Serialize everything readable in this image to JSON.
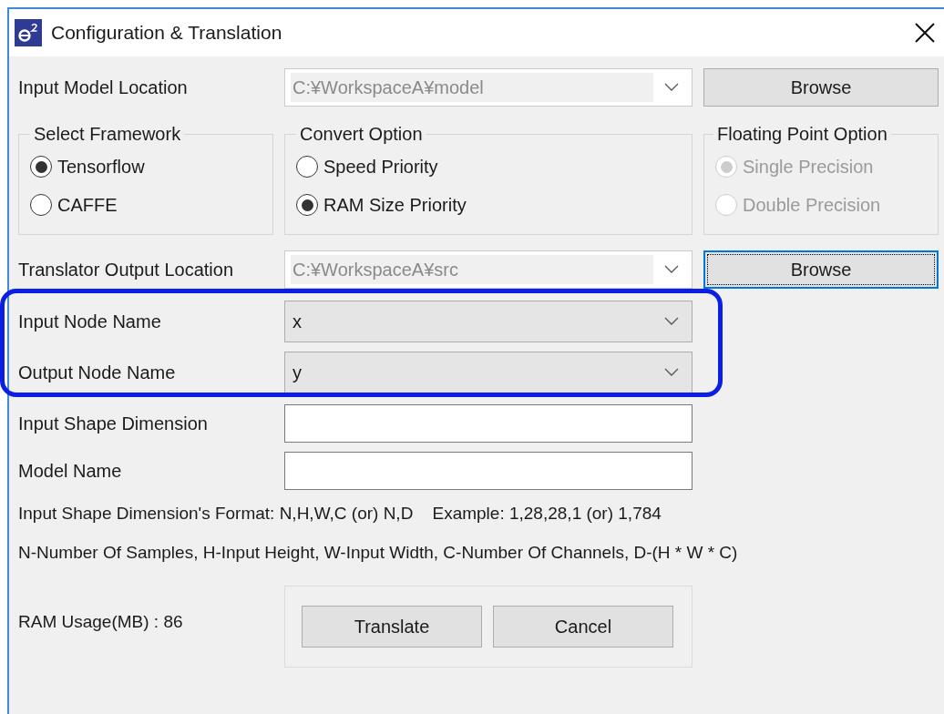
{
  "window": {
    "title": "Configuration & Translation"
  },
  "input_model_location": {
    "label": "Input Model Location",
    "value": "C:¥WorkspaceA¥model",
    "button": "Browse",
    "focused": false
  },
  "groups": [
    {
      "title": "Select Framework",
      "disabled": false,
      "options": [
        {
          "label": "Tensorflow",
          "selected": true
        },
        {
          "label": "CAFFE",
          "selected": false
        }
      ]
    },
    {
      "title": "Convert Option",
      "disabled": false,
      "options": [
        {
          "label": "Speed Priority",
          "selected": false
        },
        {
          "label": "RAM Size Priority",
          "selected": true
        }
      ]
    },
    {
      "title": "Floating Point Option",
      "disabled": true,
      "options": [
        {
          "label": "Single Precision",
          "selected": true
        },
        {
          "label": "Double Precision",
          "selected": false
        }
      ]
    }
  ],
  "translator_output_location": {
    "label": "Translator Output Location",
    "value": "C:¥WorkspaceA¥src",
    "button": "Browse",
    "focused": true
  },
  "node_names": [
    {
      "label": "Input Node Name",
      "value": "x"
    },
    {
      "label": "Output Node Name",
      "value": "y"
    }
  ],
  "text_fields": [
    {
      "label": "Input Shape Dimension"
    },
    {
      "label": "Model Name"
    }
  ],
  "notes": [
    "Input Shape Dimension's Format: N,H,W,C (or) N,D    Example: 1,28,28,1 (or) 1,784",
    "N-Number Of Samples, H-Input Height, W-Input Width, C-Number Of Channels, D-(H * W * C)"
  ],
  "ram_usage": "RAM Usage(MB) : 86",
  "buttons": [
    "Translate",
    "Cancel"
  ]
}
